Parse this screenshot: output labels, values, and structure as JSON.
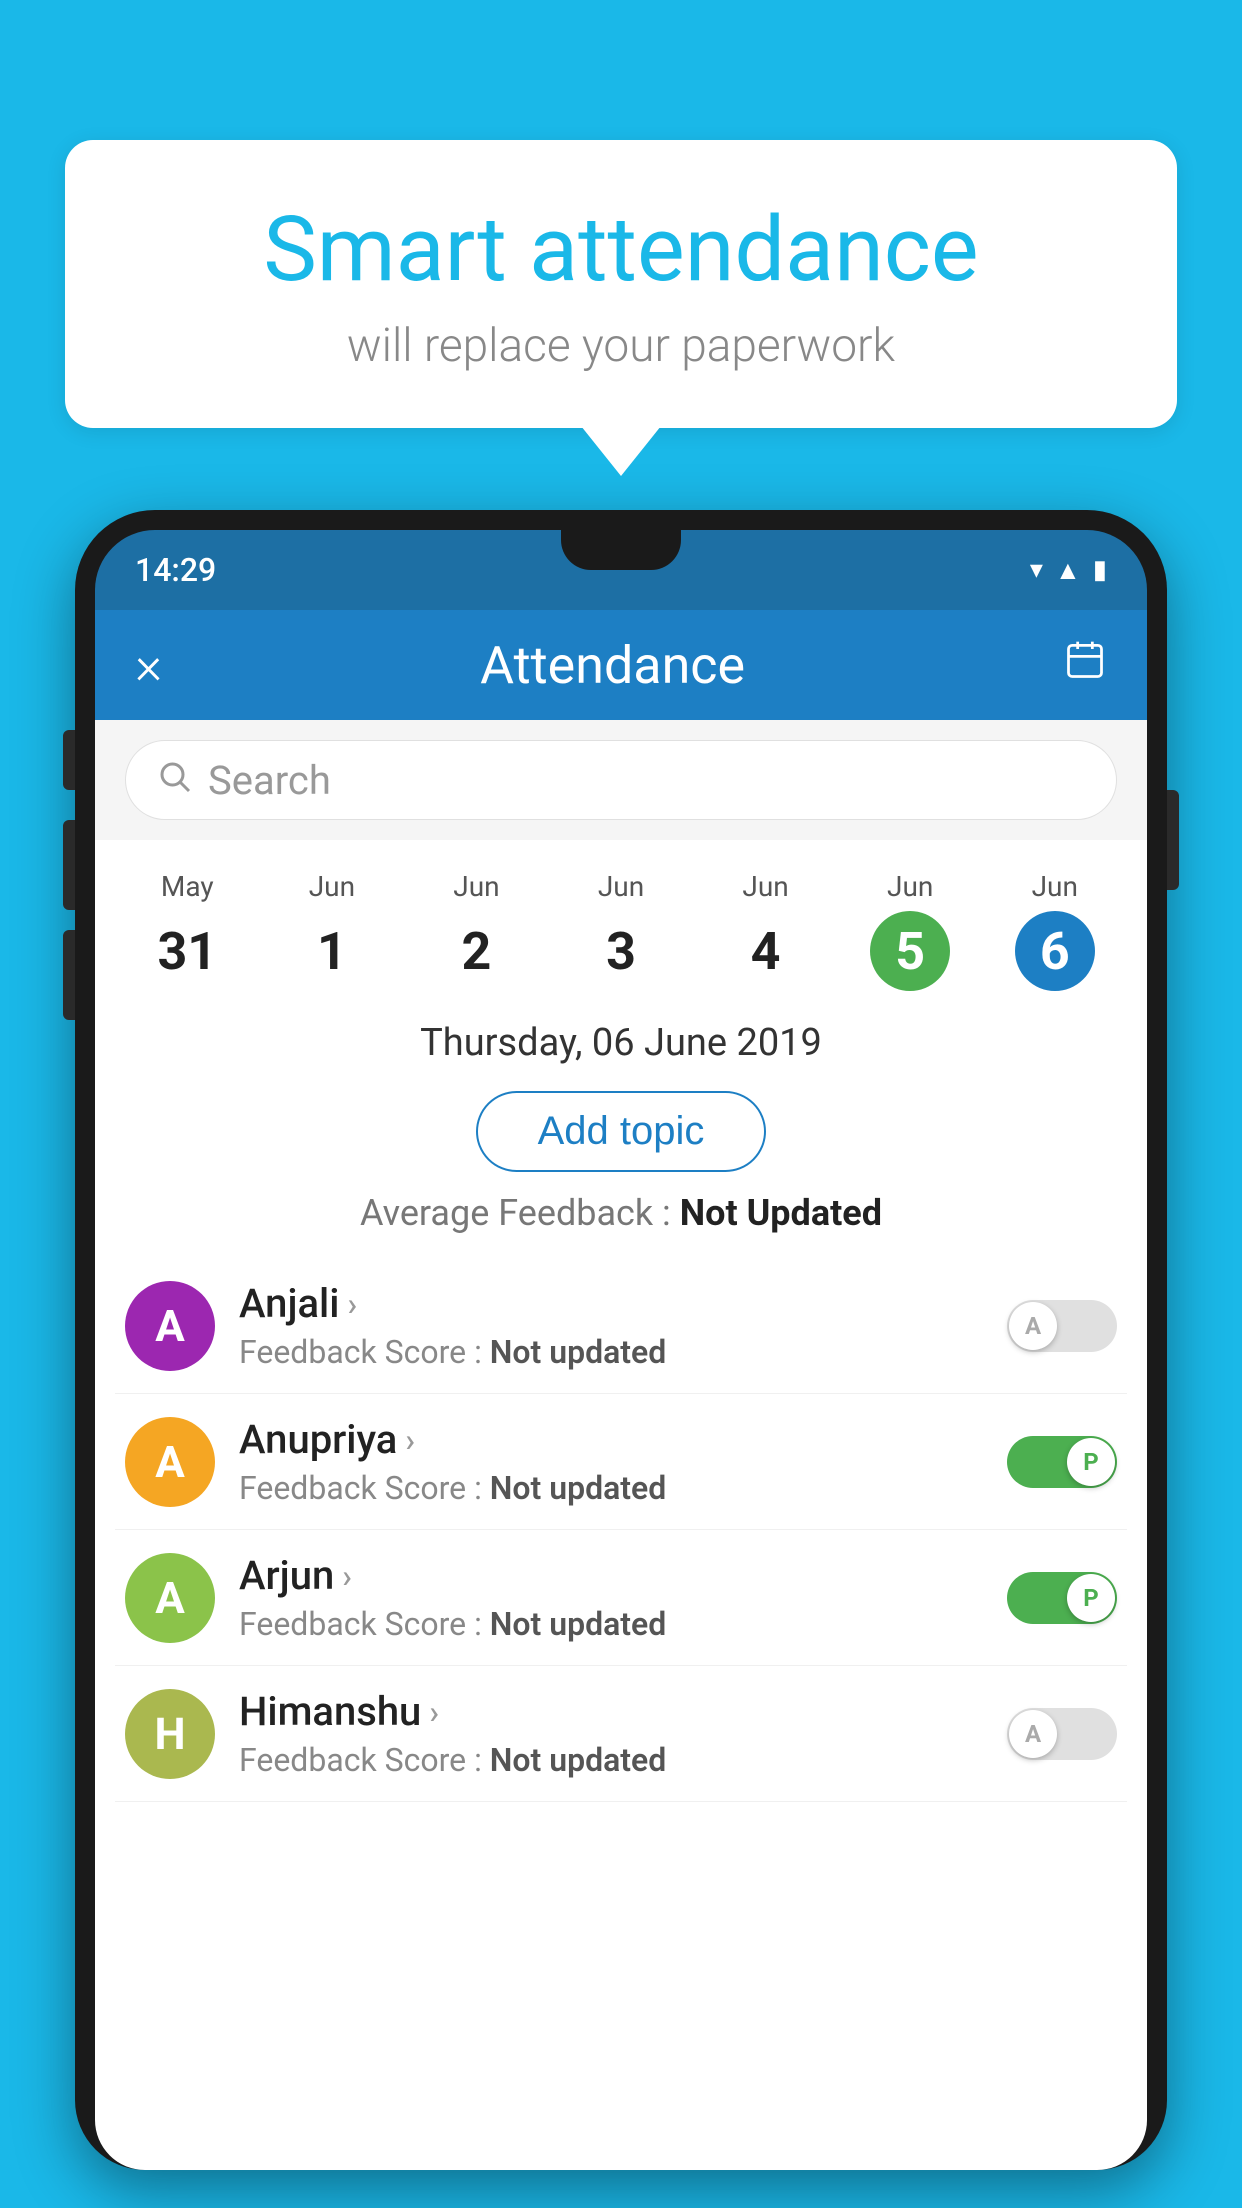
{
  "background_color": "#1ab8e8",
  "speech_bubble": {
    "title": "Smart attendance",
    "subtitle": "will replace your paperwork"
  },
  "phone": {
    "status_bar": {
      "time": "14:29",
      "icons": [
        "wifi",
        "signal",
        "battery"
      ]
    },
    "header": {
      "close_label": "×",
      "title": "Attendance",
      "calendar_icon": "🗓"
    },
    "search": {
      "placeholder": "Search"
    },
    "dates": [
      {
        "month": "May",
        "day": "31",
        "state": "normal"
      },
      {
        "month": "Jun",
        "day": "1",
        "state": "normal"
      },
      {
        "month": "Jun",
        "day": "2",
        "state": "normal"
      },
      {
        "month": "Jun",
        "day": "3",
        "state": "normal"
      },
      {
        "month": "Jun",
        "day": "4",
        "state": "normal"
      },
      {
        "month": "Jun",
        "day": "5",
        "state": "today"
      },
      {
        "month": "Jun",
        "day": "6",
        "state": "selected"
      }
    ],
    "selected_date_label": "Thursday, 06 June 2019",
    "add_topic_label": "Add topic",
    "avg_feedback_label": "Average Feedback : ",
    "avg_feedback_value": "Not Updated",
    "students": [
      {
        "name": "Anjali",
        "avatar_letter": "A",
        "avatar_color": "#9c27b0",
        "feedback_label": "Feedback Score : ",
        "feedback_value": "Not updated",
        "toggle_state": "off",
        "toggle_label": "A"
      },
      {
        "name": "Anupriya",
        "avatar_letter": "A",
        "avatar_color": "#f5a623",
        "feedback_label": "Feedback Score : ",
        "feedback_value": "Not updated",
        "toggle_state": "on",
        "toggle_label": "P"
      },
      {
        "name": "Arjun",
        "avatar_letter": "A",
        "avatar_color": "#8bc34a",
        "feedback_label": "Feedback Score : ",
        "feedback_value": "Not updated",
        "toggle_state": "on",
        "toggle_label": "P"
      },
      {
        "name": "Himanshu",
        "avatar_letter": "H",
        "avatar_color": "#aab84f",
        "feedback_label": "Feedback Score : ",
        "feedback_value": "Not updated",
        "toggle_state": "off",
        "toggle_label": "A"
      }
    ]
  }
}
